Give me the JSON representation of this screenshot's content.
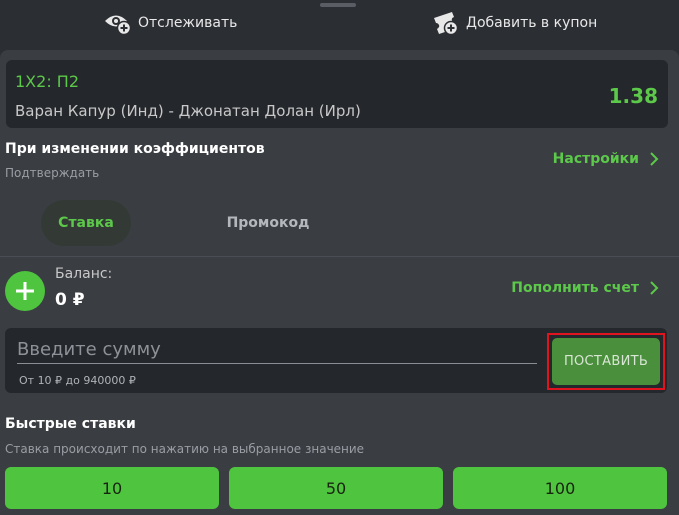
{
  "top_actions": {
    "track_label": "Отслеживать",
    "add_coupon_label": "Добавить в купон"
  },
  "bet": {
    "type": "1X2: П2",
    "event": "Варан Капур (Инд) - Джонатан Долан (Ирл)",
    "odds": "1.38"
  },
  "odds_change": {
    "title": "При изменении коэффициентов",
    "mode": "Подтверждать",
    "settings_label": "Настройки"
  },
  "tabs": [
    {
      "label": "Ставка",
      "active": true
    },
    {
      "label": "Промокод",
      "active": false
    }
  ],
  "balance": {
    "label": "Баланс:",
    "value": "0 ₽",
    "topup_label": "Пополнить счет"
  },
  "amount": {
    "placeholder": "Введите сумму",
    "value": "",
    "hint": "От 10 ₽ до 940000 ₽",
    "place_button": "ПОСТАВИТЬ"
  },
  "quick_bets": {
    "title": "Быстрые ставки",
    "subtitle": "Ставка происходит по нажатию на выбранное значение",
    "values": [
      "10",
      "50",
      "100"
    ]
  },
  "colors": {
    "accent_green": "#5cc94a",
    "button_green": "#4fc43f",
    "highlight_red": "#e0141e",
    "background": "#3a3d42",
    "card": "#24272b"
  },
  "icons": [
    "eye-plus-icon",
    "ticket-plus-icon",
    "chevron-right-icon",
    "plus-icon"
  ]
}
